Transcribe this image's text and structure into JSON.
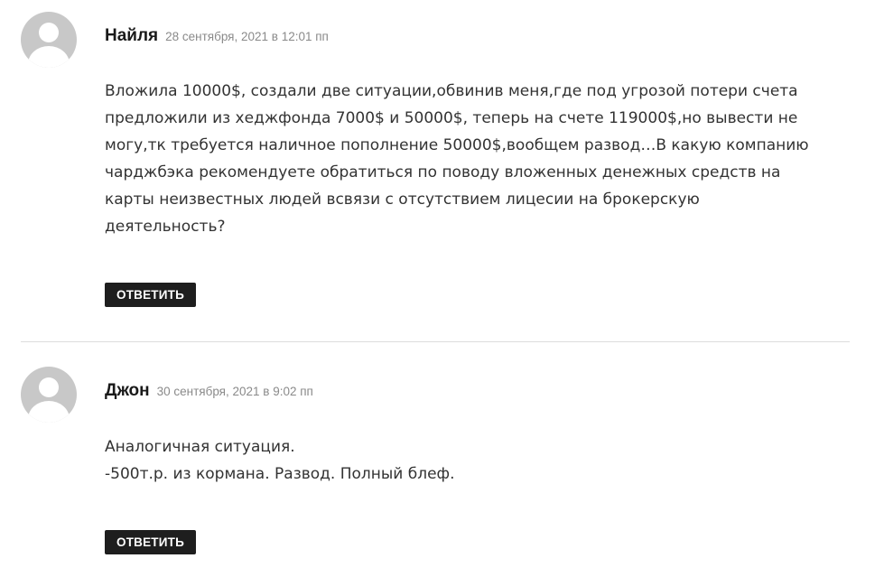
{
  "comments": [
    {
      "author": "Найля",
      "date": "28 сентября, 2021 в 12:01 пп",
      "lines": [
        "Вложила 10000$, создали две ситуации,обвинив меня,где под угрозой потери счета",
        "предложили из хеджфонда 7000$ и 50000$, теперь на счете 119000$,но вывести не",
        "могу,тк требуется наличное пополнение 50000$,вообщем развод…В какую компанию",
        "чарджбэка рекомендуете обратиться по поводу вложенных денежных средств на",
        "карты неизвестных людей всвязи с отсутствием лицесии на брокерскую",
        "деятельность?"
      ],
      "reply_label": "ОТВЕТИТЬ",
      "avatar_icon": "default-user-avatar-icon"
    },
    {
      "author": "Джон",
      "date": "30 сентября, 2021 в 9:02 пп",
      "lines": [
        "Аналогичная ситуация.",
        "-500т.р. из кормана. Развод. Полный блеф."
      ],
      "reply_label": "ОТВЕТИТЬ",
      "avatar_icon": "default-user-avatar-icon"
    }
  ],
  "colors": {
    "button_bg": "#1e1e1e",
    "button_text": "#ffffff",
    "date_text": "#8a8a8a",
    "body_text": "#333333",
    "avatar_bg": "#c8c8c8",
    "divider": "#dddddd"
  }
}
